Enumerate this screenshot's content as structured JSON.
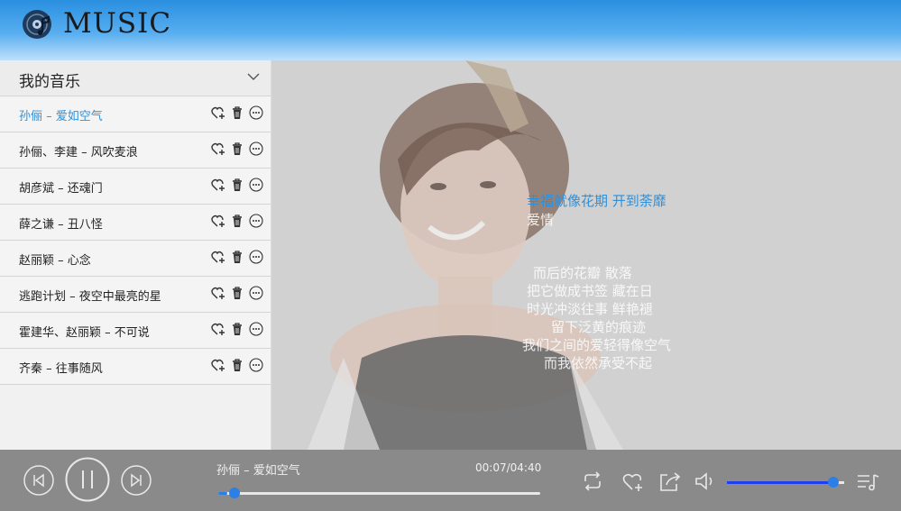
{
  "app": {
    "title": "MUSIC",
    "logo_icon": "music-disc-icon"
  },
  "sidebar": {
    "title": "我的音乐",
    "toggle_icon": "chevron-down-icon",
    "songs": [
      {
        "label": "孙俪 – 爱如空气",
        "active": true
      },
      {
        "label": "孙俪、李建 – 风吹麦浪"
      },
      {
        "label": "胡彦斌 – 还魂门"
      },
      {
        "label": "薛之谦 – 丑八怪"
      },
      {
        "label": "赵丽颖 – 心念"
      },
      {
        "label": "逃跑计划 – 夜空中最亮的星"
      },
      {
        "label": "霍建华、赵丽颖 – 不可说"
      },
      {
        "label": "齐秦 – 往事随风"
      }
    ],
    "row_icons": [
      "heart-add-icon",
      "trash-icon",
      "more-icon"
    ]
  },
  "lyrics": {
    "current": "幸福就像花期  开到荼靡",
    "lines": [
      "爱情",
      "而后的花瓣  散落",
      "把它做成书签  藏在日",
      "时光冲淡往事  鲜艳褪",
      "留下泛黄的痕迹",
      "我们之间的爱轻得像空气",
      "而我依然承受不起"
    ]
  },
  "player": {
    "now_playing": "孙俪 – 爱如空气",
    "time": "00:07/04:40",
    "progress_fraction": 0.029,
    "volume_fraction": 0.91,
    "accent": "#2b7fe6",
    "icons": [
      "prev-icon",
      "pause-icon",
      "next-icon",
      "repeat-icon",
      "heart-add-icon",
      "share-icon",
      "volume-icon",
      "playlist-icon"
    ]
  }
}
